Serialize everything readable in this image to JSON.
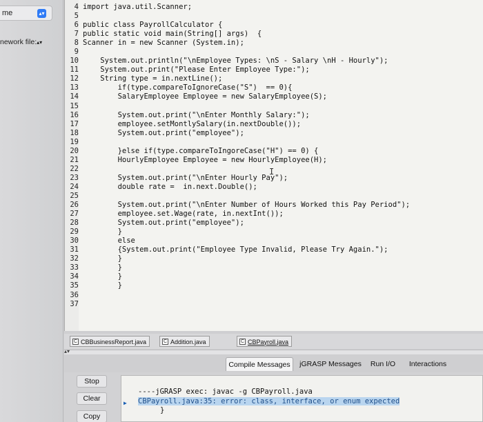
{
  "sidebar": {
    "top_label": "me",
    "framework_label": "nework file:",
    "framework_arrows": "▴▾"
  },
  "editor": {
    "lines": [
      {
        "num": "4",
        "text": "import java.util.Scanner;"
      },
      {
        "num": "5",
        "text": ""
      },
      {
        "num": "6",
        "text": "public class PayrollCalculator {"
      },
      {
        "num": "7",
        "text": "public static void main(String[] args)  {"
      },
      {
        "num": "8",
        "text": "Scanner in = new Scanner (System.in);"
      },
      {
        "num": "9",
        "text": ""
      },
      {
        "num": "10",
        "text": "    System.out.println(\"\\nEmployee Types: \\nS - Salary \\nH - Hourly\");"
      },
      {
        "num": "11",
        "text": "    System.out.print(\"Please Enter Employee Type:\");"
      },
      {
        "num": "12",
        "text": "    String type = in.nextLine();"
      },
      {
        "num": "13",
        "text": "        if(type.compareToIgnoreCase(\"S\")  == 0){"
      },
      {
        "num": "14",
        "text": "        SalaryEmployee Employee = new SalaryEmployee(S);"
      },
      {
        "num": "15",
        "text": ""
      },
      {
        "num": "16",
        "text": "        System.out.print(\"\\nEnter Monthly Salary:\");"
      },
      {
        "num": "17",
        "text": "        employee.setMontlySalary(in.nextDouble());"
      },
      {
        "num": "18",
        "text": "        System.out.print(\"employee\");"
      },
      {
        "num": "19",
        "text": ""
      },
      {
        "num": "20",
        "text": "        }else if(type.compareToIngoreCase(\"H\") == 0) {"
      },
      {
        "num": "21",
        "text": "        HourlyEmployee Employee = new HourlyEmployee(H);"
      },
      {
        "num": "22",
        "text": ""
      },
      {
        "num": "23",
        "text": "        System.out.print(\"\\nEnter Hourly Pay\");"
      },
      {
        "num": "24",
        "text": "        double rate =  in.next.Double();"
      },
      {
        "num": "25",
        "text": ""
      },
      {
        "num": "26",
        "text": "        System.out.print(\"\\nEnter Number of Hours Worked this Pay Period\");"
      },
      {
        "num": "27",
        "text": "        employee.set.Wage(rate, in.nextInt());"
      },
      {
        "num": "28",
        "text": "        System.out.print(\"employee\");"
      },
      {
        "num": "29",
        "text": "        }"
      },
      {
        "num": "30",
        "text": "        else"
      },
      {
        "num": "31",
        "text": "        {System.out.print(\"Employee Type Invalid, Please Try Again.\");"
      },
      {
        "num": "32",
        "text": "        }"
      },
      {
        "num": "33",
        "text": "        }"
      },
      {
        "num": "34",
        "text": "        }"
      },
      {
        "num": "35",
        "text": "        }"
      },
      {
        "num": "36",
        "text": ""
      },
      {
        "num": "37",
        "text": ""
      }
    ],
    "cursor_glyph": "I"
  },
  "file_tabs": [
    {
      "label": "CBBusinessReport.java",
      "icon_text": "C"
    },
    {
      "label": "Addition.java",
      "icon_text": "C"
    },
    {
      "label": "CBPayroll.java",
      "icon_text": "C"
    }
  ],
  "message_tabs": {
    "compile": "Compile Messages",
    "jgrasp": "jGRASP Messages",
    "run_io": "Run I/O",
    "interactions": "Interactions"
  },
  "output": {
    "stop": "Stop",
    "clear": "Clear",
    "copy": "Copy",
    "exec_line": "----jGRASP exec: javac -g CBPayroll.java",
    "error_line": "CBPayroll.java:35: error: class, interface, or enum expected",
    "brace_line": "}",
    "error_marker": "▶"
  },
  "divider_arrows": "▴▾"
}
